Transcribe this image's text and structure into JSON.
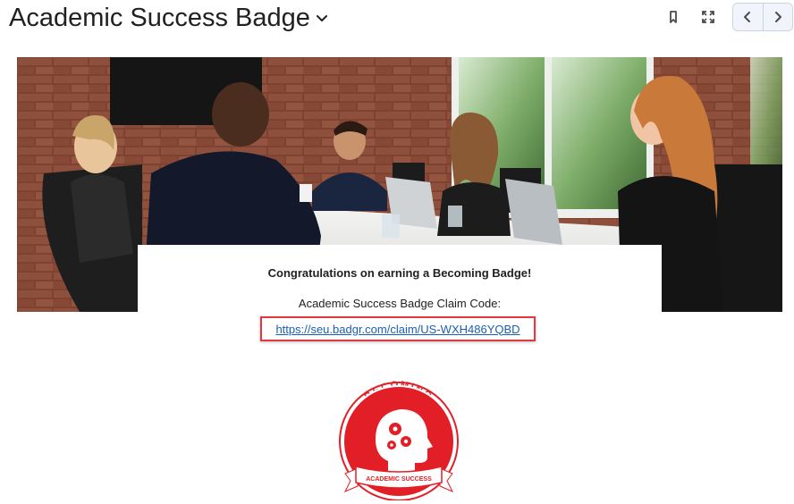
{
  "header": {
    "title": "Academic Success Badge",
    "icons": {
      "title_menu": "chevron-down-icon",
      "bookmark": "bookmark-icon",
      "fullscreen": "fullscreen-icon",
      "previous": "chevron-left-icon",
      "next": "chevron-right-icon"
    }
  },
  "content": {
    "congrats_text": "Congratulations on earning a Becoming Badge!",
    "claim_label": "Academic Success Badge Claim Code:",
    "claim_link": "https://seu.badgr.com/claim/US-WXH486YQBD"
  },
  "badge": {
    "top_text": "BECOMING",
    "ribbon_text": "ACADEMIC SUCCESS"
  },
  "colors": {
    "badge_red": "#e21f26",
    "highlight_border": "#e0393f",
    "link": "#1a5fb4"
  }
}
